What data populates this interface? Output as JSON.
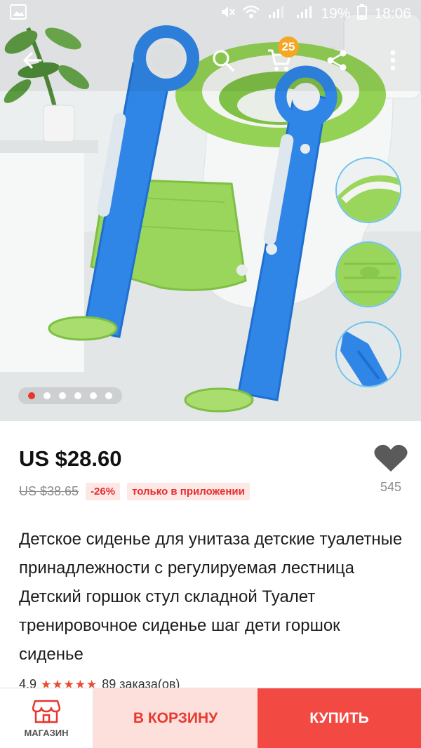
{
  "status_bar": {
    "battery_percent": "19%",
    "time": "18:06"
  },
  "toolbar": {
    "cart_count": "25"
  },
  "gallery": {
    "total_images": 6,
    "active_index": 0,
    "thumbnails": [
      "seat-closeup",
      "step-texture",
      "frame-detail"
    ]
  },
  "product": {
    "price": "US $28.60",
    "old_price": "US $38.65",
    "discount": "-26%",
    "app_only_tag": "только в приложении",
    "wishlist_count": "545",
    "title": "Детское сиденье для унитаза детские туалетные принадлежности с регулируемая лестница Детский горшок стул складной Туалет тренировочное сиденье шаг дети горшок сиденье",
    "rating": "4.9",
    "stars": "★★★★★",
    "orders": "89 заказа(ов)"
  },
  "bottom_bar": {
    "store_label": "МАГАЗИН",
    "add_to_cart_label": "В КОРЗИНУ",
    "buy_label": "КУПИТЬ"
  },
  "colors": {
    "accent_red": "#f24a43",
    "cart_button_bg": "#fde0dc",
    "badge_orange": "#f5a623",
    "star_color": "#ec4b30"
  }
}
